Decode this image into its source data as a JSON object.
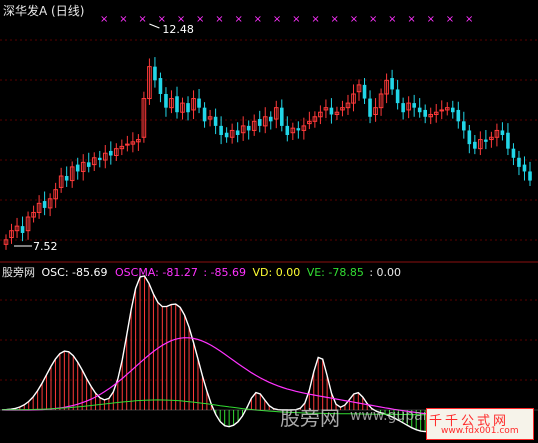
{
  "colors": {
    "bg": "#000000",
    "up": "#ff3a3a",
    "down": "#22d6e8",
    "magenta": "#ff33ff",
    "white": "#ffffff",
    "green": "#33dd33",
    "divider": "#8b1010",
    "grid": "#5a0000",
    "zero_line": "#bbbbbb",
    "title": "#e8e8e8",
    "watermark": "#c8c8c8",
    "seal": "#ff2a2a"
  },
  "header": {
    "title": "深华发A (日线)"
  },
  "price_panel": {
    "high_label": "12.48",
    "low_label": "7.52",
    "markers": 20
  },
  "indicator_header": {
    "name": "股旁网",
    "osc_label": "OSC:",
    "osc_value": "-85.69",
    "oscma_label": "OSCMA:",
    "oscma_value": "-81.27",
    "extra_value": ": -85.69",
    "vd_label": "VD:",
    "vd_value": "0.00",
    "ve_label": "VE:",
    "ve_value": "-78.85",
    "last_value": ": 0.00"
  },
  "watermark": {
    "text_cn": "股旁网",
    "text_url": "www.gupang.com",
    "seal_cn": "千千公式网",
    "seal_url": "www.fdx001.com"
  },
  "chart_data": [
    {
      "type": "candlestick",
      "title": "深华发A (日线)",
      "x": "trading days (unlabeled)",
      "y_range": [
        7.52,
        12.48
      ],
      "annotations": [
        {
          "label": "12.48",
          "kind": "high"
        },
        {
          "label": "7.52",
          "kind": "low"
        }
      ],
      "close": [
        7.7,
        7.9,
        8.0,
        7.85,
        8.2,
        8.3,
        8.5,
        8.4,
        8.6,
        8.8,
        9.1,
        9.0,
        9.3,
        9.2,
        9.4,
        9.3,
        9.5,
        9.45,
        9.6,
        9.55,
        9.7,
        9.75,
        9.8,
        9.85,
        9.9,
        10.8,
        11.5,
        11.2,
        10.9,
        10.6,
        10.8,
        10.5,
        10.7,
        10.5,
        10.8,
        10.6,
        10.3,
        10.4,
        10.2,
        10.0,
        9.95,
        10.1,
        10.0,
        10.2,
        10.1,
        10.3,
        10.2,
        10.4,
        10.3,
        10.6,
        10.2,
        10.0,
        10.15,
        10.1,
        10.2,
        10.3,
        10.4,
        10.5,
        10.6,
        10.45,
        10.5,
        10.6,
        10.7,
        10.9,
        11.1,
        10.8,
        10.4,
        10.6,
        10.9,
        11.2,
        11.0,
        10.7,
        10.5,
        10.7,
        10.6,
        10.5,
        10.4,
        10.45,
        10.5,
        10.55,
        10.6,
        10.5,
        10.3,
        10.1,
        9.8,
        9.7,
        9.9,
        9.85,
        9.95,
        10.1,
        10.0,
        9.7,
        9.5,
        9.3,
        9.2,
        9.0
      ]
    },
    {
      "type": "line",
      "title": "股旁网",
      "series": [
        {
          "name": "OSC",
          "last": -85.69
        },
        {
          "name": "OSCMA",
          "last": -81.27
        },
        {
          "name": "VD",
          "last": 0.0
        },
        {
          "name": "VE",
          "last": -78.85
        }
      ]
    }
  ]
}
